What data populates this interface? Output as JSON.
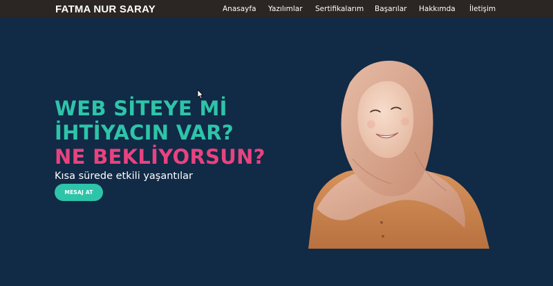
{
  "nav": {
    "brand": "FATMA NUR SARAY",
    "items": [
      "Anasayfa",
      "Yazılımlar",
      "Sertifikalarım",
      "Başarılar",
      "Hakkımda",
      "İletişim"
    ]
  },
  "hero": {
    "line1": "WEB SİTEYE Mİ",
    "line2": "İHTİYACIN VAR?",
    "line3": "NE BEKLİYORSUN?",
    "subtitle": "Kısa sürede etkili yaşantılar",
    "cta_label": "MESAJ AT"
  },
  "colors": {
    "background": "#112a46",
    "navbar": "#2b2523",
    "teal": "#2ec4a9",
    "pink": "#e8437f"
  },
  "icons": {
    "cursor": "mouse-pointer-icon"
  }
}
